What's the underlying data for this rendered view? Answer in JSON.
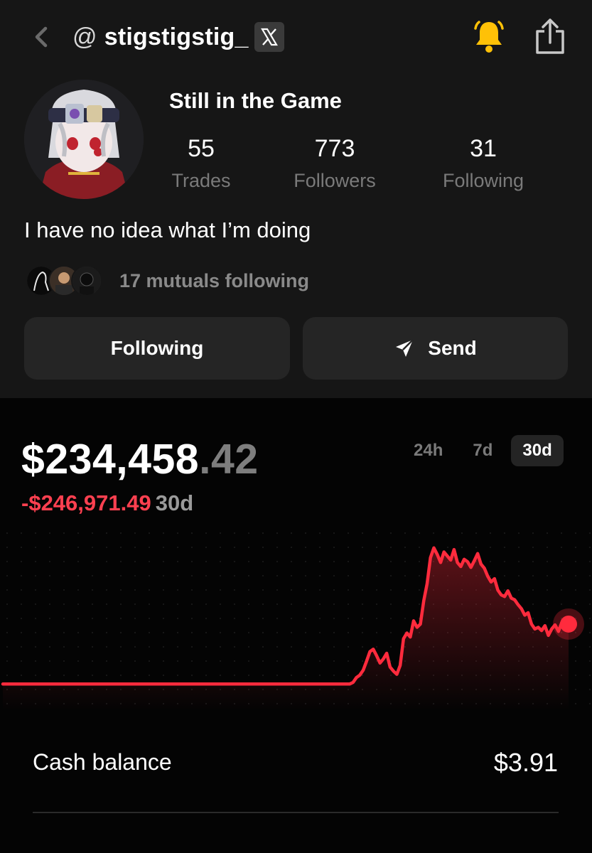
{
  "header": {
    "at": "@",
    "handle": "stigstigstig_",
    "x_badge": "X",
    "icons": [
      "back-chevron-icon",
      "x-logo-icon",
      "bell-icon",
      "share-icon"
    ],
    "bell_color": "#ffc107"
  },
  "profile": {
    "display_name": "Still in the Game",
    "stats": [
      {
        "value": "55",
        "label": "Trades"
      },
      {
        "value": "773",
        "label": "Followers"
      },
      {
        "value": "31",
        "label": "Following"
      }
    ],
    "bio": "I have no idea what I’m doing",
    "mutuals_text": "17 mutuals following"
  },
  "actions": {
    "following_label": "Following",
    "send_label": "Send"
  },
  "portfolio": {
    "value_main": "$234,458",
    "value_cents": ".42",
    "change": "-$246,971.49",
    "change_period": "30d",
    "ranges": [
      "24h",
      "7d",
      "30d"
    ],
    "active_range": "30d",
    "accent_color": "#ff2b3d"
  },
  "chart_data": {
    "type": "line",
    "series": [
      {
        "values": [
          12,
          12,
          12,
          12,
          12,
          12,
          12,
          12,
          12,
          12,
          12,
          12,
          12,
          12,
          12,
          12,
          12,
          12,
          12,
          12,
          12,
          12,
          12,
          12,
          12,
          12,
          12,
          12,
          12,
          12,
          12,
          12,
          12,
          12,
          12,
          12,
          12,
          12,
          12,
          12,
          12,
          12,
          12,
          12,
          12,
          12,
          12,
          12,
          12,
          12,
          12,
          12,
          12,
          12,
          12,
          12,
          12,
          12,
          12,
          12,
          12,
          12,
          12,
          12,
          12,
          12,
          12,
          12,
          12,
          12,
          12,
          12,
          12,
          12,
          12,
          12,
          12,
          12,
          12,
          12,
          12,
          12,
          12,
          12,
          12,
          12,
          12,
          12,
          12,
          12,
          12,
          12,
          12,
          12,
          12,
          12,
          12,
          12,
          12,
          12,
          12,
          12,
          12,
          12,
          14,
          20,
          23,
          29,
          40,
          52,
          55,
          47,
          38,
          43,
          50,
          33,
          28,
          24,
          35,
          68,
          75,
          70,
          90,
          82,
          86,
          115,
          136,
          168,
          180,
          172,
          162,
          175,
          170,
          165,
          178,
          162,
          157,
          166,
          163,
          156,
          164,
          173,
          160,
          155,
          145,
          138,
          142,
          128,
          122,
          120,
          127,
          118,
          116,
          110,
          105,
          97,
          100,
          86,
          80,
          82,
          78,
          84,
          72,
          80,
          85,
          77,
          88,
          90,
          86
        ]
      }
    ],
    "ylim": [
      0,
      200
    ],
    "grid": false
  },
  "cash": {
    "label": "Cash balance",
    "value": "$3.91"
  }
}
